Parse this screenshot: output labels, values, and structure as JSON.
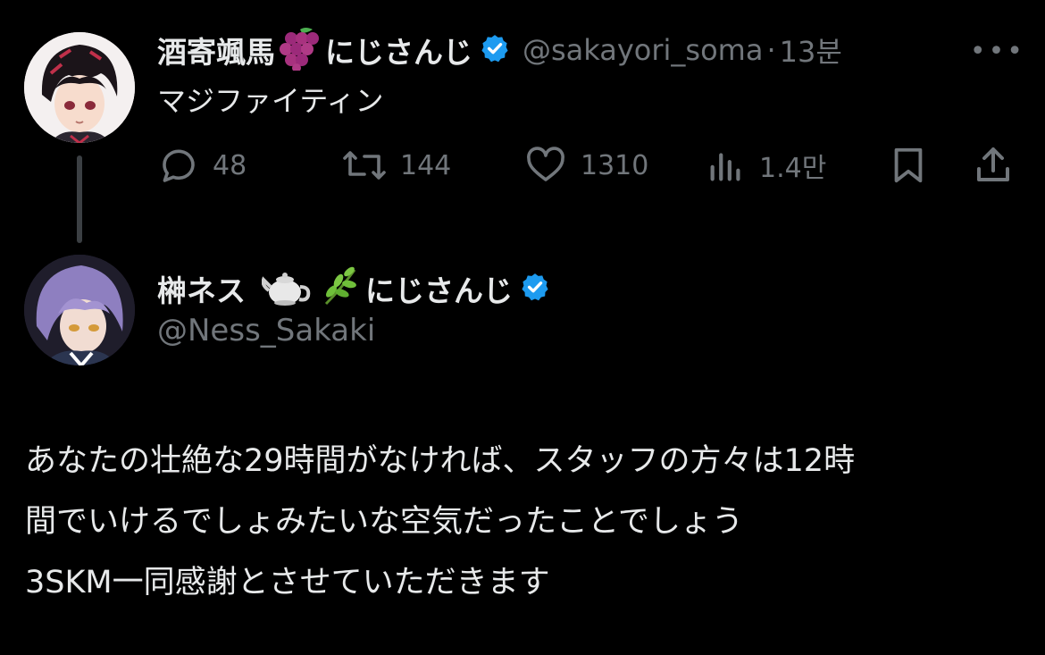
{
  "parent_tweet": {
    "display_name": "酒寄颯馬",
    "name_emoji": "grape-icon",
    "affiliation": "にじさんじ",
    "handle": "@sakayori_soma",
    "separator": "·",
    "time": "13분",
    "text": "マジファイティン",
    "stats": {
      "replies": "48",
      "retweets": "144",
      "likes": "1310",
      "views": "1.4만"
    }
  },
  "reply_tweet": {
    "display_name": "榊ネス",
    "name_emojis": [
      "teapot-icon",
      "herb-icon"
    ],
    "affiliation": "にじさんじ",
    "handle": "@Ness_Sakaki",
    "text_lines": [
      "あなたの壮絶な29時間がなければ、スタッフの方々は12時",
      "間でいけるでしょみたいな空気だったことでしょう",
      "3SKM一同感謝とさせていただきます"
    ]
  },
  "colors": {
    "background": "#000000",
    "text": "#e7e9ea",
    "muted": "#71767b",
    "verified": "#1d9bf0",
    "thread_line": "#3b3f43"
  }
}
